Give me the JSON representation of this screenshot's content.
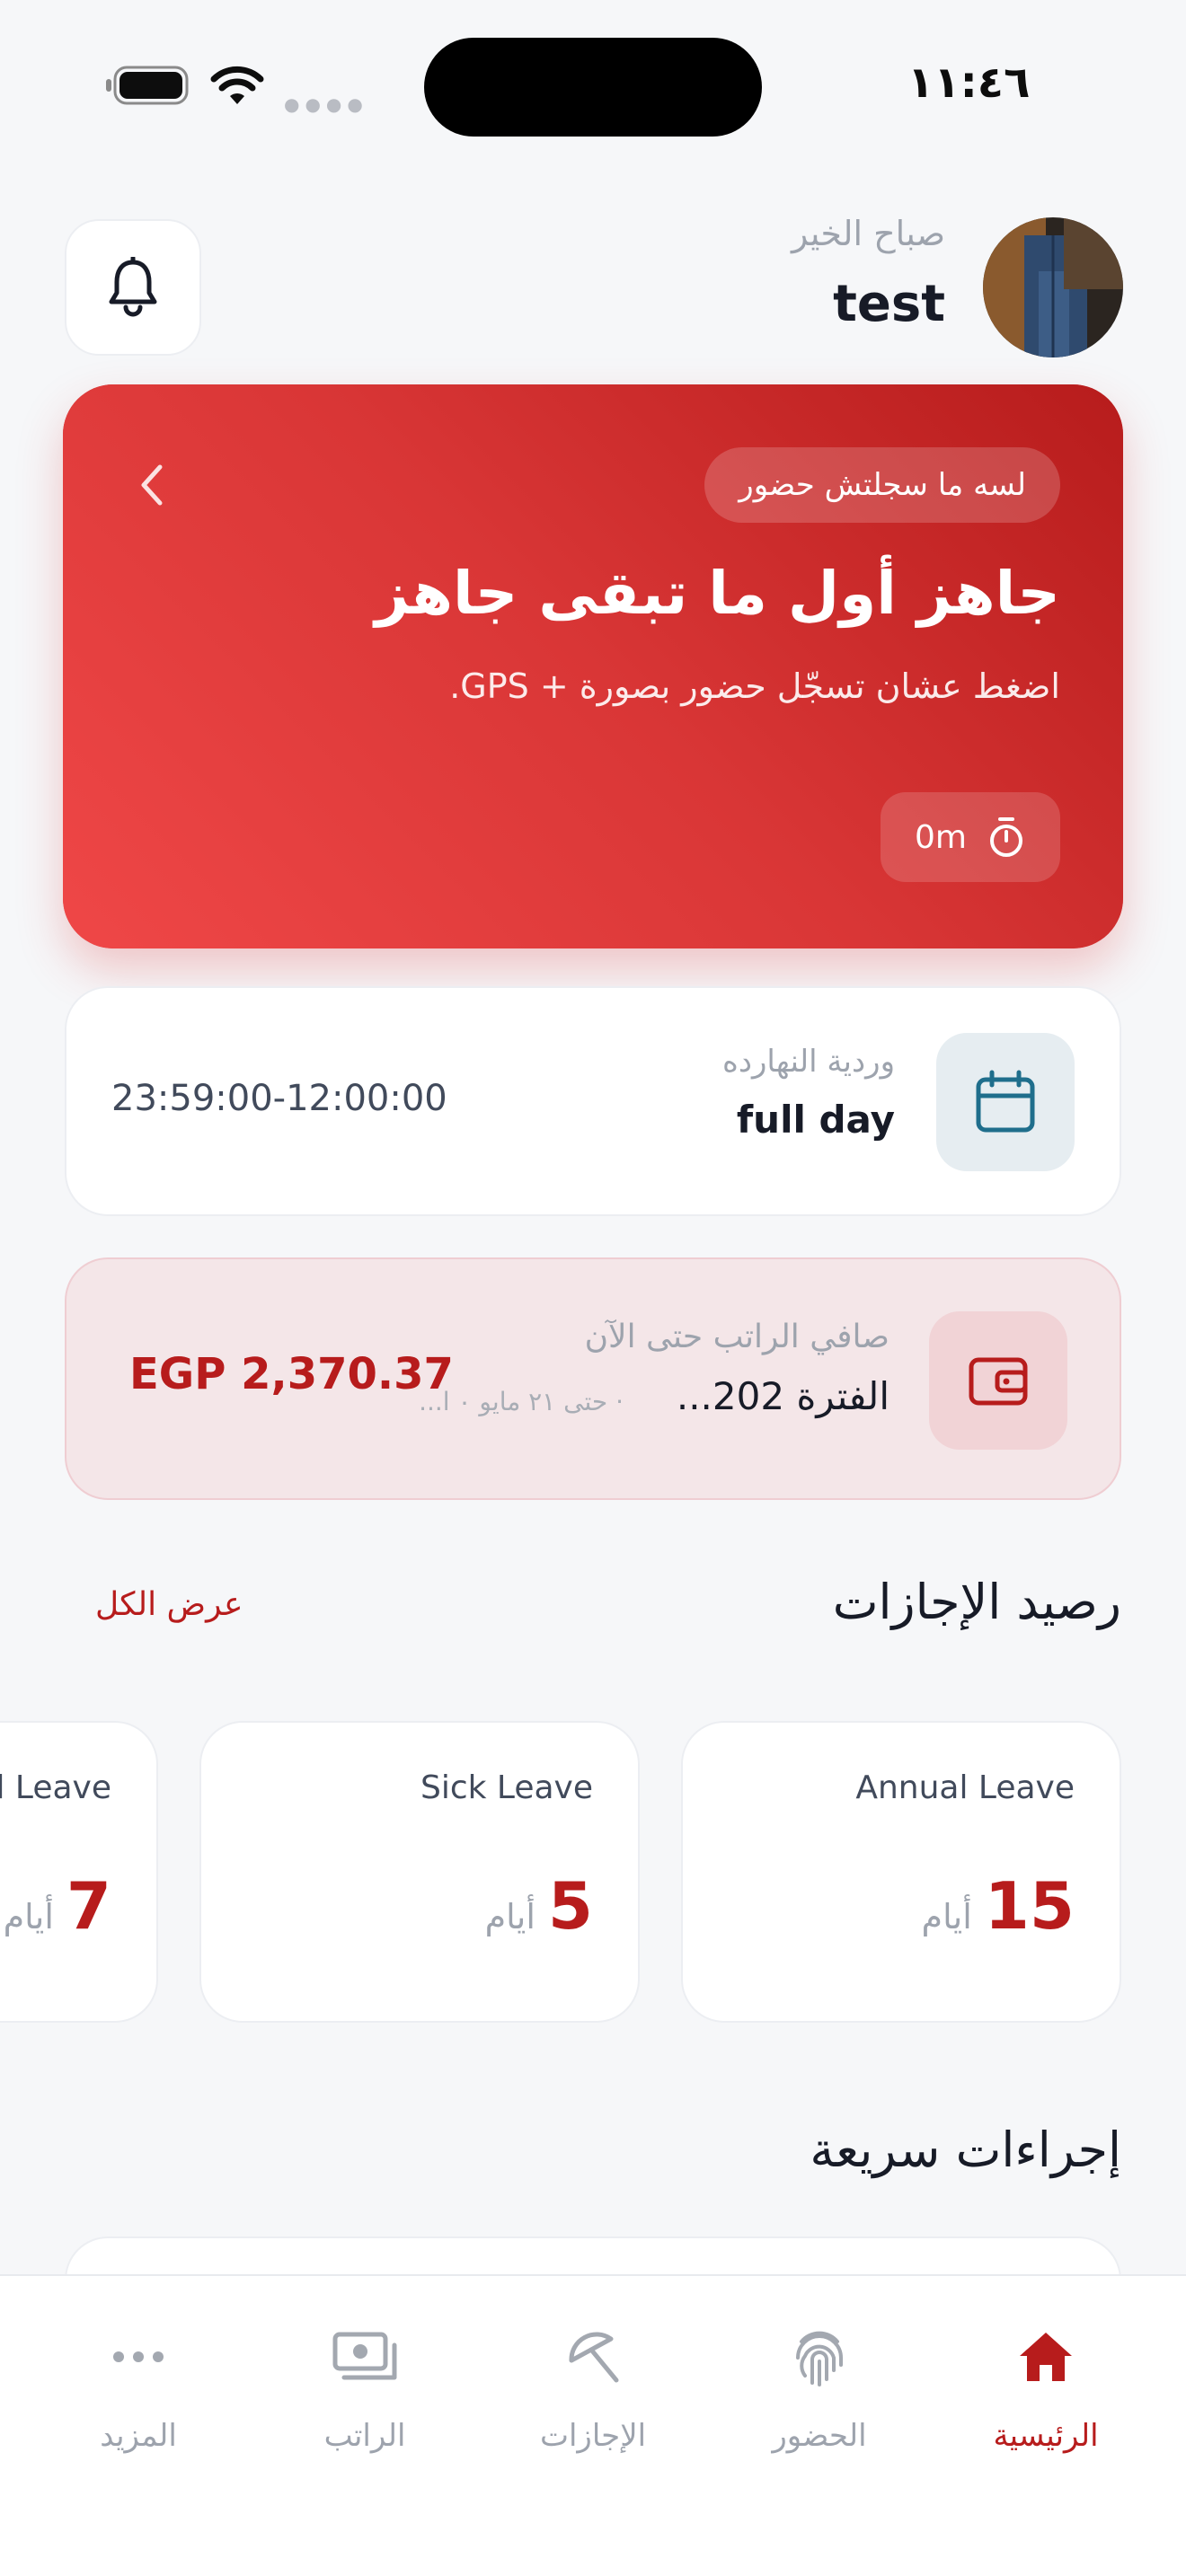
{
  "status_bar": {
    "time": "١١:٤٦"
  },
  "header": {
    "greeting": "صباح الخير",
    "username": "test"
  },
  "hero": {
    "badge": "لسه ما سجلتش حضور",
    "title": "جاهز أول ما تبقى جاهز",
    "subtitle": "اضغط عشان تسجّل حضور بصورة + GPS.",
    "timer": "0m"
  },
  "shift": {
    "label": "وردية النهارده",
    "name": "full day",
    "hours": "23:59:00-12:00:00"
  },
  "salary": {
    "label": "صافي الراتب حتى الآن",
    "period": "الفترة 202...",
    "period_sub": "· حتى ٢١ مايو ٠ ا...",
    "amount": "EGP 2,370.37"
  },
  "leave_section": {
    "title": "رصيد الإجازات",
    "view_all": "عرض الكل",
    "cards": [
      {
        "name": "Annual Leave",
        "value": "15",
        "unit": "أيام"
      },
      {
        "name": "Sick Leave",
        "value": "5",
        "unit": "أيام"
      },
      {
        "name": "l Leave",
        "value": "7",
        "unit": "أيام"
      }
    ]
  },
  "quick_actions": {
    "title": "إجراءات سريعة"
  },
  "nav": {
    "items": [
      {
        "label": "الرئيسية",
        "icon": "home-icon",
        "active": true
      },
      {
        "label": "الحضور",
        "icon": "fingerprint-icon",
        "active": false
      },
      {
        "label": "الإجازات",
        "icon": "umbrella-icon",
        "active": false
      },
      {
        "label": "الراتب",
        "icon": "money-icon",
        "active": false
      },
      {
        "label": "المزيد",
        "icon": "more-icon",
        "active": false
      }
    ]
  },
  "colors": {
    "primary": "#b71c1c",
    "hero_light": "#ef4444",
    "background": "#f6f7f9"
  }
}
